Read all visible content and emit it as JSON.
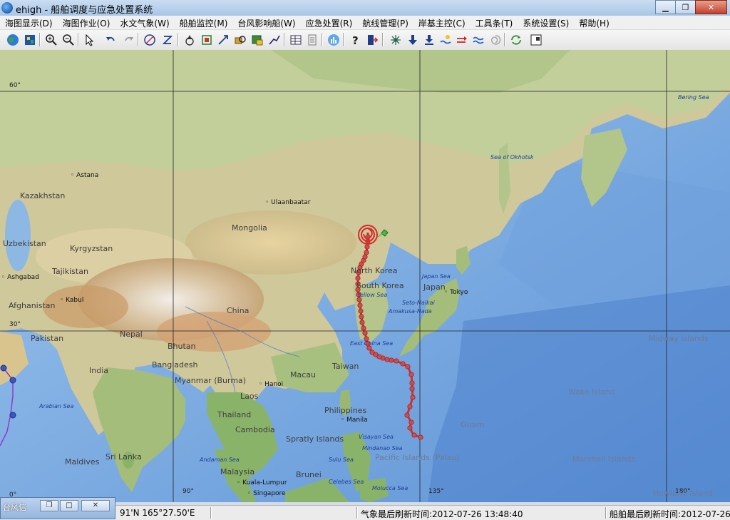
{
  "window": {
    "title": "ehigh - 船舶调度与应急处置系统"
  },
  "menu": [
    "海图显示(D)",
    "海图作业(O)",
    "水文气象(W)",
    "船舶监控(M)",
    "台风影响船(W)",
    "应急处置(R)",
    "航线管理(P)",
    "岸基主控(C)",
    "工具条(T)",
    "系统设置(S)",
    "帮助(H)"
  ],
  "toolbar": {
    "buttons": [
      "globe-icon",
      "chart-layers-icon",
      "zoom-in-icon",
      "zoom-out-icon",
      "select-arrow-icon",
      "undo-icon",
      "redo-icon",
      "measure-circle-icon",
      "measure-z-icon",
      "ship-track-icon",
      "ship-select-icon",
      "route-cross-icon",
      "find-ship-icon",
      "ship-list-icon",
      "line-tool-icon",
      "table-icon",
      "document-icon",
      "statistics-icon",
      "help-icon",
      "exit-icon",
      "typhoon-icon",
      "arrow-down-icon",
      "arrow-down-bar-icon",
      "tide-icon",
      "current-icon",
      "wave-icon",
      "vortex-icon",
      "refresh-icon",
      "window-icon"
    ]
  },
  "map": {
    "grid_labels": {
      "lat60": "60°",
      "lat30": "30°",
      "lat0": "0°",
      "lon90": "90°",
      "lon135": "135°",
      "lon180": "180°"
    },
    "countries": [
      "Kazakhstan",
      "Mongolia",
      "Uzbekistan",
      "Kyrgyzstan",
      "Tajikistan",
      "Afghanistan",
      "Pakistan",
      "Nepal",
      "Bhutan",
      "India",
      "Bangladesh",
      "Myanmar (Burma)",
      "Laos",
      "Thailand",
      "Cambodia",
      "China",
      "North Korea",
      "South Korea",
      "Japan",
      "Taiwan",
      "Macau",
      "Philippines",
      "Malaysia",
      "Brunei",
      "Sri Lanka",
      "Maldives"
    ],
    "cities": [
      "Astana",
      "Ulaanbaatar",
      "Ashgabad",
      "Kabul",
      "Tokyo",
      "Hanoi",
      "Manila",
      "Kuala-Lumpur",
      "Singapore"
    ],
    "seas": [
      "Bering Sea",
      "Sea of Okhotsk",
      "Japan Sea",
      "Yellow Sea",
      "Seto-Naikai",
      "Amakusa-Nada",
      "East China Sea",
      "Arabian Sea",
      "Andaman Sea",
      "Spratly Islands",
      "Visayan Sea",
      "Mindanao Sea",
      "Sulu Sea",
      "Celebes Sea",
      "Molucca Sea"
    ],
    "islands": [
      "Midway Islands",
      "Wake Island",
      "Guam",
      "Pacific Islands (Palau)",
      "Marshall Islands",
      "Howland Island"
    ],
    "track_color": "#d13a3a",
    "ship_marker_color": "#2ca02c"
  },
  "statusbar": {
    "coords": "91'N    165°27.50'E",
    "weather_refresh": "气象最后刷新时间:2012-07-26 13:48:40",
    "ship_refresh": "船舶最后刷新时间:2012-07-26"
  },
  "mini_window": {
    "title": "台风信"
  }
}
